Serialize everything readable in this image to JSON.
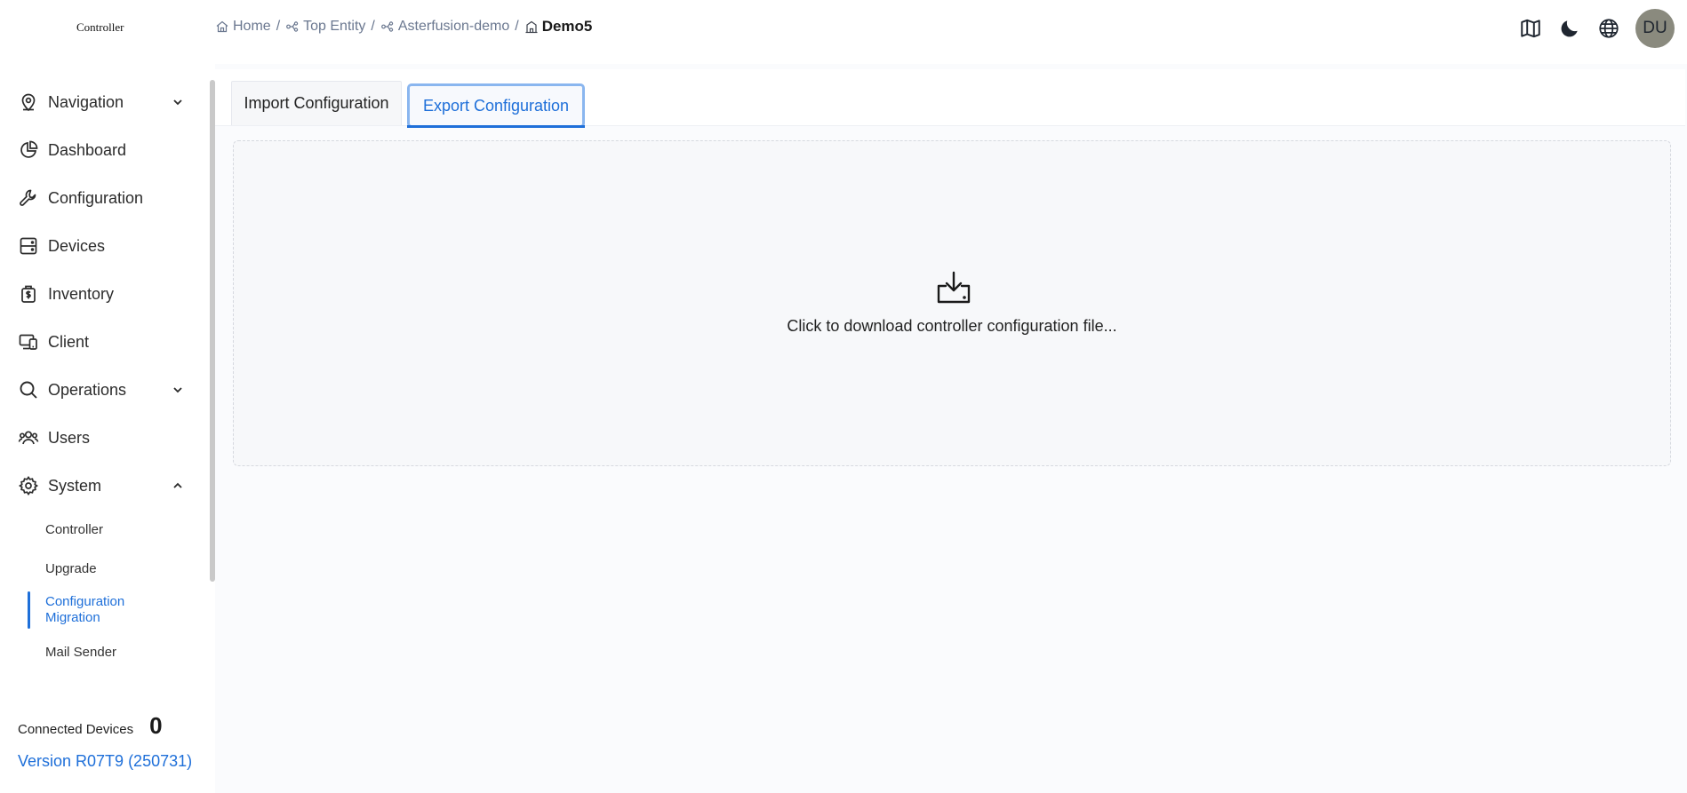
{
  "header": {
    "logo": "Controller",
    "breadcrumb": [
      {
        "label": "Home",
        "icon": "home-icon"
      },
      {
        "label": "Top Entity",
        "icon": "entity-icon"
      },
      {
        "label": "Asterfusion-demo",
        "icon": "entity-icon"
      }
    ],
    "breadcrumb_sep": "/",
    "breadcrumb_current": {
      "label": "Demo5",
      "icon": "venue-icon"
    },
    "actions": [
      "map-icon",
      "moon-icon",
      "globe-icon"
    ],
    "avatar_initials": "DU"
  },
  "sidebar": {
    "items": [
      {
        "label": "Navigation",
        "icon": "location-pin-icon",
        "chevron": "down"
      },
      {
        "label": "Dashboard",
        "icon": "pie-chart-icon"
      },
      {
        "label": "Configuration",
        "icon": "wrench-icon"
      },
      {
        "label": "Devices",
        "icon": "server-icon"
      },
      {
        "label": "Inventory",
        "icon": "inventory-icon"
      },
      {
        "label": "Client",
        "icon": "client-devices-icon"
      },
      {
        "label": "Operations",
        "icon": "search-icon",
        "chevron": "down"
      },
      {
        "label": "Users",
        "icon": "users-icon"
      },
      {
        "label": "System",
        "icon": "gear-icon",
        "chevron": "up"
      }
    ],
    "system_sub": [
      {
        "label": "Controller"
      },
      {
        "label": "Upgrade"
      },
      {
        "label_line1": "Configuration",
        "label_line2": "Migration",
        "active": true
      },
      {
        "label": "Mail Sender"
      }
    ],
    "footer": {
      "connected_label": "Connected Devices",
      "connected_count": "0",
      "version": "Version R07T9 (250731)"
    }
  },
  "main": {
    "tabs": [
      {
        "label": "Import Configuration",
        "active": false
      },
      {
        "label": "Export Configuration",
        "active": true
      }
    ],
    "export": {
      "icon": "download-icon",
      "text": "Click to download controller configuration file..."
    }
  },
  "colors": {
    "accent": "#1e6fd9",
    "tab_focus_ring": "#8ab6ef",
    "avatar_bg": "#8a8a7e"
  }
}
